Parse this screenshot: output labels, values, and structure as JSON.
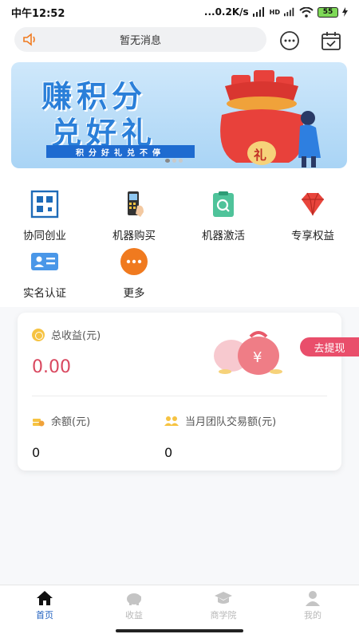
{
  "status_bar": {
    "time": "中午12:52",
    "network_speed": "...0.2K/s",
    "signal_label": "HD",
    "battery": "55"
  },
  "header": {
    "notice": "暂无消息",
    "icons": [
      "speaker-icon",
      "chat-icon",
      "calendar-check-icon"
    ]
  },
  "banner": {
    "line1": "赚积分",
    "line2": "兑好礼",
    "subtitle": "积分好礼兑不停",
    "gift_char": "礼",
    "pages": 3,
    "active_page": 1
  },
  "menu": [
    {
      "label": "协同创业",
      "icon": "qr-code-icon",
      "color": "#1e6bb8"
    },
    {
      "label": "机器购买",
      "icon": "pos-machine-icon",
      "color": "#333333"
    },
    {
      "label": "机器激活",
      "icon": "activate-clipboard-icon",
      "color": "#3bb58a"
    },
    {
      "label": "专享权益",
      "icon": "ruby-gem-icon",
      "color": "#e8453c"
    },
    {
      "label": "实名认证",
      "icon": "id-card-icon",
      "color": "#3a8ee6"
    },
    {
      "label": "更多",
      "icon": "more-dots-icon",
      "color": "#f07a1f"
    }
  ],
  "earnings": {
    "total_label": "总收益(元)",
    "total_value": "0.00",
    "balance_label": "余额(元)",
    "balance_value": "0",
    "team_label": "当月团队交易额(元)",
    "team_value": "0",
    "withdraw_label": "去提现"
  },
  "tabbar": [
    {
      "label": "首页",
      "icon": "home-icon",
      "active": true
    },
    {
      "label": "收益",
      "icon": "piggy-bank-icon",
      "active": false
    },
    {
      "label": "商学院",
      "icon": "graduation-cap-icon",
      "active": false
    },
    {
      "label": "我的",
      "icon": "user-icon",
      "active": false
    }
  ],
  "colors": {
    "accent": "#1f5fbf",
    "value_red": "#d9485f",
    "withdraw_bg": "#e94e6b"
  }
}
